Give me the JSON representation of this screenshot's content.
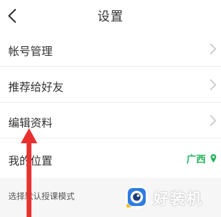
{
  "header": {
    "title": "设置"
  },
  "settings": {
    "items": [
      {
        "label": "帐号管理"
      },
      {
        "label": "推荐给好友"
      },
      {
        "label": "编辑资料"
      }
    ],
    "location": {
      "label": "我的位置",
      "value": "广西"
    },
    "teaching_mode": {
      "label": "选择默认授课模式"
    }
  },
  "watermark": {
    "text": "好装机"
  },
  "colors": {
    "accent": "#26b35a",
    "arrow": "#e8312f",
    "watermark_blue": "#2f7de1"
  },
  "icons": {
    "back": "chevron-left-icon",
    "row_chevron": "chevron-right-icon",
    "location_pin": "map-pin-icon",
    "annotation": "red-arrow-icon",
    "watermark_logo": "eye-logo-icon"
  }
}
